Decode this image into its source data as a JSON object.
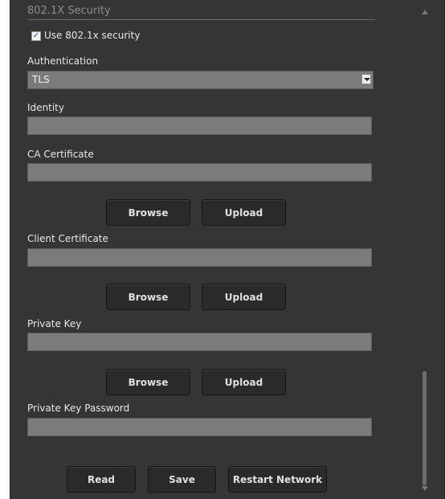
{
  "section": {
    "title": "802.1X Security"
  },
  "use_8021x": {
    "checked": true,
    "label": "Use 802.1x security",
    "check_glyph": "✓"
  },
  "authentication": {
    "label": "Authentication",
    "value": "TLS"
  },
  "identity": {
    "label": "Identity",
    "value": ""
  },
  "ca_certificate": {
    "label": "CA Certificate",
    "value": "",
    "browse_label": "Browse",
    "upload_label": "Upload"
  },
  "client_certificate": {
    "label": "Client Certificate",
    "value": "",
    "browse_label": "Browse",
    "upload_label": "Upload"
  },
  "private_key": {
    "label": "Private Key",
    "value": "",
    "browse_label": "Browse",
    "upload_label": "Upload"
  },
  "private_key_password": {
    "label": "Private Key Password",
    "value": ""
  },
  "actions": {
    "read_label": "Read",
    "save_label": "Save",
    "restart_label": "Restart Network"
  },
  "icons": {
    "dropdown": "chevron-down-icon",
    "scroll_up": "scroll-up-arrow-icon",
    "scroll_down": "scroll-down-arrow-icon"
  },
  "colors": {
    "panel_bg": "#353535",
    "field_bg": "#7b7b7b",
    "button_bg": "#2a2a2a",
    "text": "#e8e8e8",
    "section_title": "#8c8c8c"
  }
}
